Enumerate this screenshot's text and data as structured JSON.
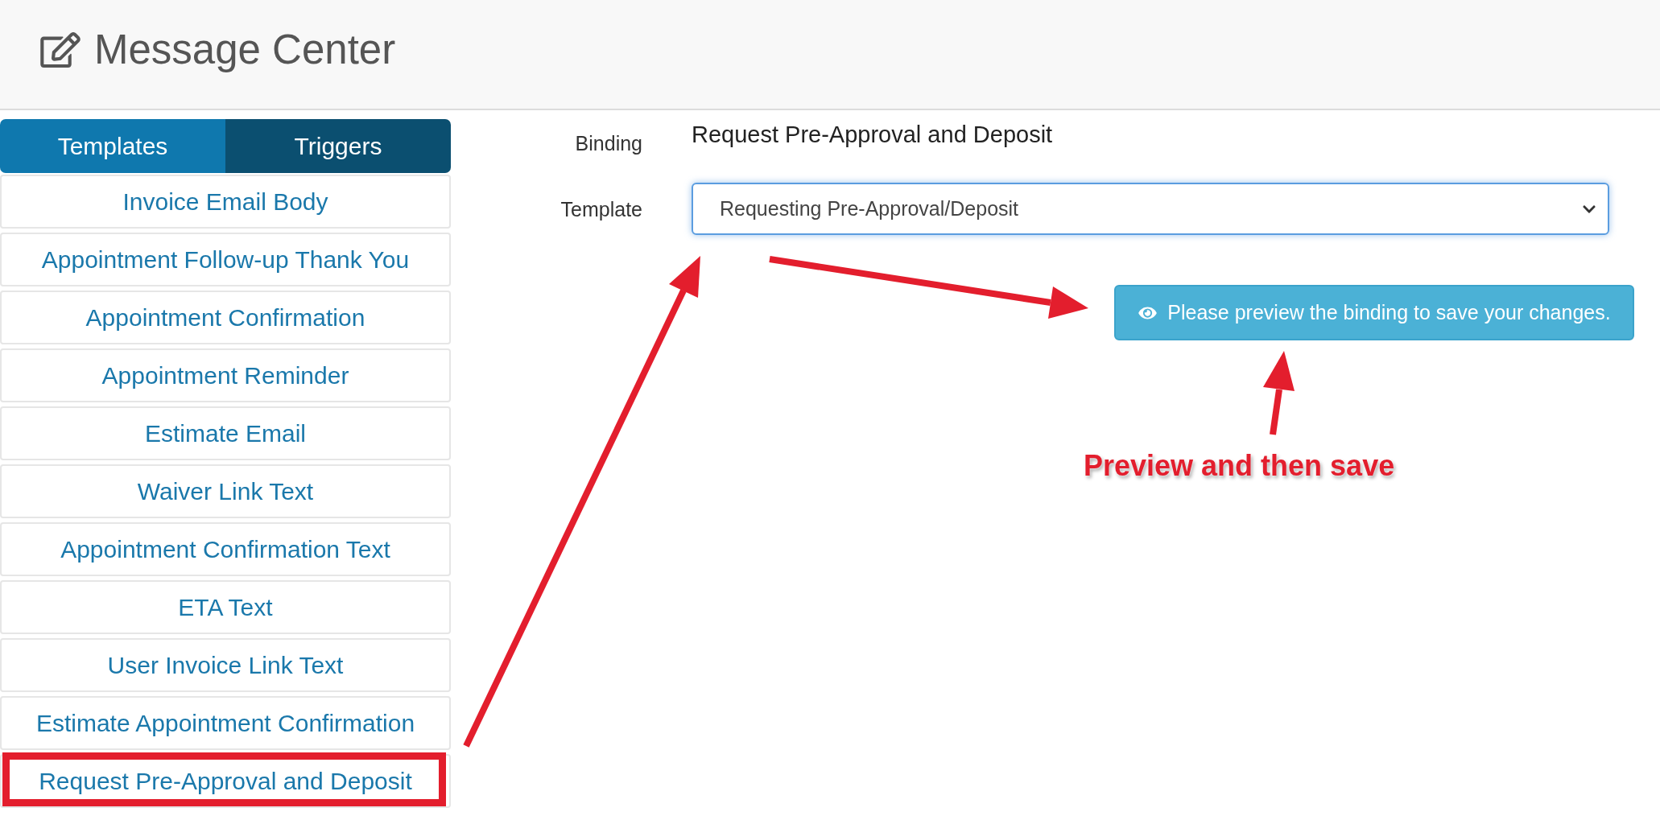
{
  "header": {
    "title": "Message Center"
  },
  "sidebar": {
    "tabs": [
      {
        "label": "Templates",
        "selected": true
      },
      {
        "label": "Triggers",
        "selected": false
      }
    ],
    "templates": [
      {
        "label": "Invoice Email Body",
        "highlighted": false
      },
      {
        "label": "Appointment Follow-up Thank You",
        "highlighted": false
      },
      {
        "label": "Appointment Confirmation",
        "highlighted": false
      },
      {
        "label": "Appointment Reminder",
        "highlighted": false
      },
      {
        "label": "Estimate Email",
        "highlighted": false
      },
      {
        "label": "Waiver Link Text",
        "highlighted": false
      },
      {
        "label": "Appointment Confirmation Text",
        "highlighted": false
      },
      {
        "label": "ETA Text",
        "highlighted": false
      },
      {
        "label": "User Invoice Link Text",
        "highlighted": false
      },
      {
        "label": "Estimate Appointment Confirmation",
        "highlighted": false
      },
      {
        "label": "Request Pre-Approval and Deposit",
        "highlighted": true
      }
    ]
  },
  "form": {
    "binding": {
      "label": "Binding",
      "value": "Request Pre-Approval and Deposit"
    },
    "template": {
      "label": "Template",
      "value": "Requesting Pre-Approval/Deposit",
      "focused": true
    },
    "preview_button": "Please preview the binding to save your changes."
  },
  "annotation": {
    "callout": "Preview and then save"
  }
}
